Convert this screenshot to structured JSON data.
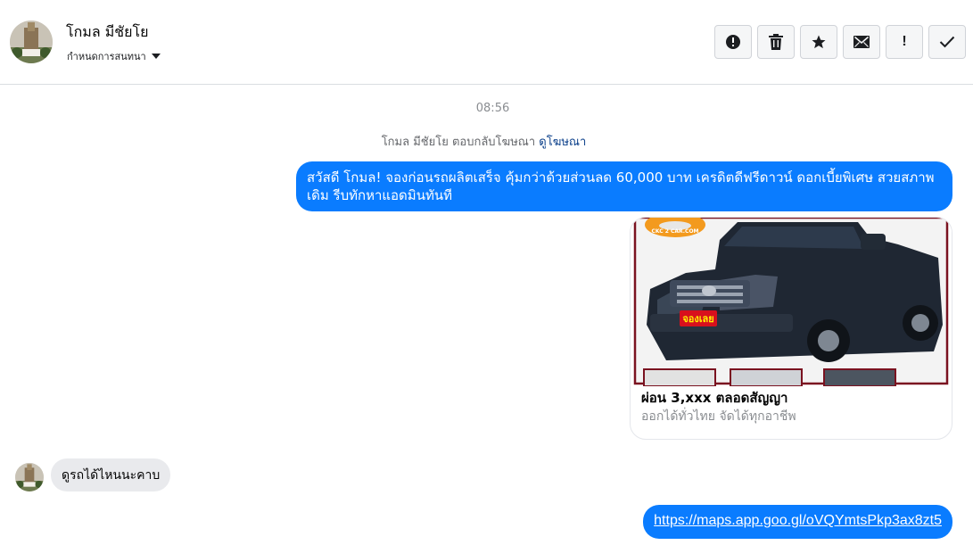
{
  "header": {
    "contact_name": "โกมล มีชัยโย",
    "subtitle": "กำหนดการสนทนา",
    "actions": [
      {
        "name": "report-button",
        "icon": "alert-circle-icon"
      },
      {
        "name": "delete-button",
        "icon": "trash-icon"
      },
      {
        "name": "star-button",
        "icon": "star-icon"
      },
      {
        "name": "mark-unread-button",
        "icon": "envelope-icon"
      },
      {
        "name": "important-button",
        "icon": "exclamation-icon",
        "label": "!"
      },
      {
        "name": "done-button",
        "icon": "checkmark-icon"
      }
    ]
  },
  "thread": {
    "timestamp": "08:56",
    "reply_note": "โกมล มีชัยโย ตอบกลับโฆษณา",
    "reply_link": "ดูโฆษณา",
    "outgoing_message": "สวัสดี โกมล! จองก่อนรถผลิตเสร็จ คุ้มกว่าด้วยส่วนลด 60,000 บาท เครดิตดีฟรีดาวน์ ดอกเบี้ยพิเศษ สวยสภาพเดิม รีบทักหาแอดมินทันที",
    "ad_card": {
      "brand_badge": "CKC 2 CAR.COM",
      "sticker": "จองเลย",
      "title": "ผ่อน 3,xxx ตลอดสัญญา",
      "subtitle": "ออกได้ทั่วไทย จัดได้ทุกอาชีพ"
    },
    "incoming_message": "ดูรถได้ไหนนะคาบ",
    "link_message": "https://maps.app.goo.gl/oVQYmtsPkp3ax8zt5"
  },
  "colors": {
    "outgoing_bubble": "#0a7cff",
    "incoming_bubble": "#e9eaed",
    "divider": "#dadde1"
  }
}
